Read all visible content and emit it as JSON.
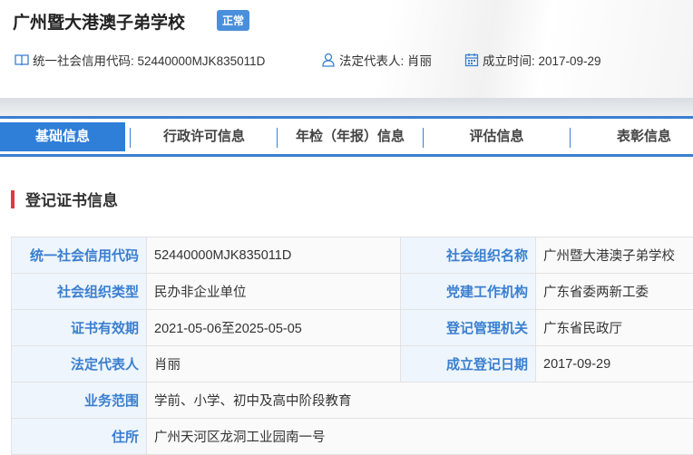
{
  "header": {
    "title": "广州暨大港澳子弟学校",
    "status": "正常",
    "credit_code": "统一社会信用代码: 52440000MJK835011D",
    "legal_rep": "法定代表人: 肖丽",
    "founded": "成立时间: 2017-09-29"
  },
  "tabs": [
    {
      "label": "基础信息",
      "active": true
    },
    {
      "label": "行政许可信息"
    },
    {
      "label": "年检（年报）信息"
    },
    {
      "label": "评估信息"
    },
    {
      "label": "表彰信息"
    }
  ],
  "section": {
    "title": "登记证书信息"
  },
  "table": {
    "rows": [
      {
        "l1": "统一社会信用代码",
        "v1": "52440000MJK835011D",
        "l2": "社会组织名称",
        "v2": "广州暨大港澳子弟学校"
      },
      {
        "l1": "社会组织类型",
        "v1": "民办非企业单位",
        "l2": "党建工作机构",
        "v2": "广东省委两新工委"
      },
      {
        "l1": "证书有效期",
        "v1": "2021-05-06至2025-05-05",
        "l2": "登记管理机关",
        "v2": "广东省民政厅"
      },
      {
        "l1": "法定代表人",
        "v1": "肖丽",
        "l2": "成立登记日期",
        "v2": "2017-09-29"
      }
    ],
    "wide_rows": [
      {
        "l": "业务范围",
        "v": "学前、小学、初中及高中阶段教育"
      },
      {
        "l": "住所",
        "v": "广州天河区龙洞工业园南一号"
      }
    ]
  }
}
